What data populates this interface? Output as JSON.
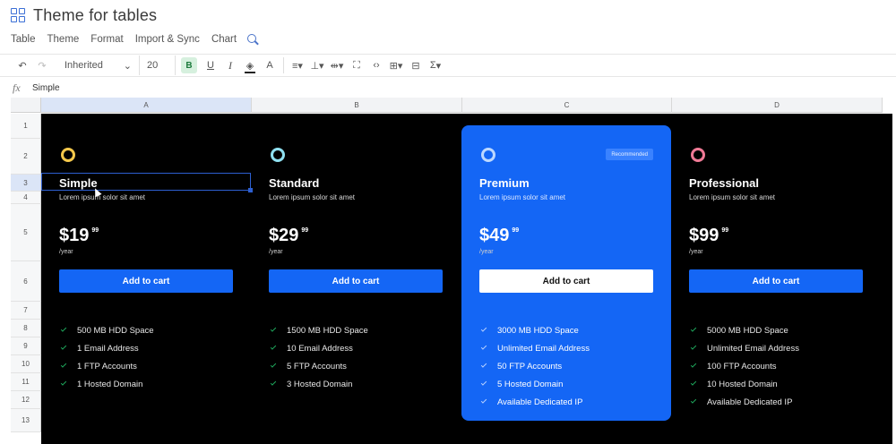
{
  "doc": {
    "title": "Theme for tables"
  },
  "menu": {
    "items": [
      "Table",
      "Theme",
      "Format",
      "Import & Sync",
      "Chart"
    ]
  },
  "toolbar": {
    "font": "Inherited",
    "size": "20",
    "bold": "B",
    "underline": "U",
    "italic": "I",
    "text_color": "A",
    "sum": "Σ"
  },
  "formula": {
    "fx": "fx",
    "value": "Simple"
  },
  "columns": [
    "A",
    "B",
    "C",
    "D"
  ],
  "rows": [
    "1",
    "2",
    "3",
    "4",
    "5",
    "6",
    "7",
    "8",
    "9",
    "10",
    "11",
    "12",
    "13"
  ],
  "plans": [
    {
      "name": "Simple",
      "desc": "Lorem ipsum solor sit amet",
      "price": "$19",
      "cents": "99",
      "period": "/year",
      "button": "Add to cart",
      "icon_color": "#f5c84b",
      "features": [
        "500 MB HDD Space",
        "1 Email Address",
        "1 FTP Accounts",
        "1 Hosted Domain"
      ]
    },
    {
      "name": "Standard",
      "desc": "Lorem ipsum solor sit amet",
      "price": "$29",
      "cents": "99",
      "period": "/year",
      "button": "Add to cart",
      "icon_color": "#8fe0f0",
      "features": [
        "1500 MB HDD Space",
        "10 Email Address",
        "5 FTP Accounts",
        "3 Hosted Domain"
      ]
    },
    {
      "name": "Premium",
      "desc": "Lorem ipsum solor sit amet",
      "price": "$49",
      "cents": "99",
      "period": "/year",
      "button": "Add to cart",
      "badge": "Recommended",
      "icon_color": "#bcd8ff",
      "features": [
        "3000 MB HDD Space",
        "Unlimited Email Address",
        "50 FTP Accounts",
        "5 Hosted Domain",
        "Available Dedicated IP"
      ]
    },
    {
      "name": "Professional",
      "desc": "Lorem ipsum solor sit amet",
      "price": "$99",
      "cents": "99",
      "period": "/year",
      "button": "Add to cart",
      "icon_color": "#f07a96",
      "features": [
        "5000 MB HDD Space",
        "Unlimited Email Address",
        "100 FTP Accounts",
        "10 Hosted Domain",
        "Available Dedicated IP"
      ]
    }
  ]
}
